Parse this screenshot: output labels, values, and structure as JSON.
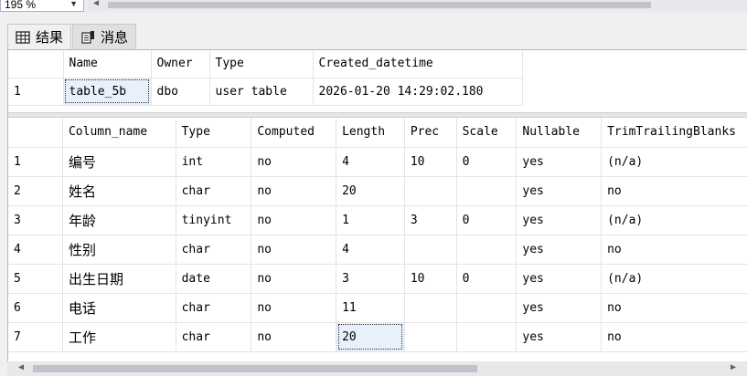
{
  "zoom": {
    "value": "195 %"
  },
  "tabs": [
    {
      "label": "结果",
      "icon": "grid-icon",
      "active": true
    },
    {
      "label": "消息",
      "icon": "messages-icon",
      "active": false
    }
  ],
  "results1": {
    "headers": [
      "Name",
      "Owner",
      "Type",
      "Created_datetime"
    ],
    "rows": [
      {
        "num": "1",
        "cells": [
          "table_5b",
          "dbo",
          "user table",
          "2026-01-20 14:29:02.180"
        ]
      }
    ]
  },
  "results2": {
    "headers": [
      "Column_name",
      "Type",
      "Computed",
      "Length",
      "Prec",
      "Scale",
      "Nullable",
      "TrimTrailingBlanks"
    ],
    "rows": [
      {
        "num": "1",
        "cells": [
          "编号",
          "int",
          "no",
          "4",
          "10",
          "0",
          "yes",
          "(n/a)"
        ]
      },
      {
        "num": "2",
        "cells": [
          "姓名",
          "char",
          "no",
          "20",
          "",
          "",
          "yes",
          "no"
        ]
      },
      {
        "num": "3",
        "cells": [
          "年龄",
          "tinyint",
          "no",
          "1",
          "3",
          "0",
          "yes",
          "(n/a)"
        ]
      },
      {
        "num": "4",
        "cells": [
          "性别",
          "char",
          "no",
          "4",
          "",
          "",
          "yes",
          "no"
        ]
      },
      {
        "num": "5",
        "cells": [
          "出生日期",
          "date",
          "no",
          "3",
          "10",
          "0",
          "yes",
          "(n/a)"
        ]
      },
      {
        "num": "6",
        "cells": [
          "电话",
          "char",
          "no",
          "11",
          "",
          "",
          "yes",
          "no"
        ]
      },
      {
        "num": "7",
        "cells": [
          "工作",
          "char",
          "no",
          "20",
          "",
          "",
          "yes",
          "no"
        ]
      }
    ]
  }
}
